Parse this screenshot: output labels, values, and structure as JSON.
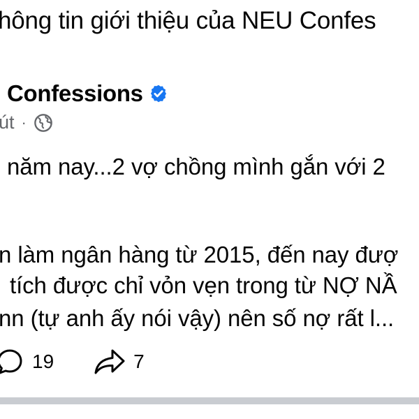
{
  "top_text": "hông tin giới thiệu của NEU Confes",
  "post": {
    "page_name": "Confessions",
    "time": "út",
    "separator": "·",
    "lines": [
      "năm nay...2 vợ chồng mình gắn với 2",
      "n làm ngân hàng từ 2015, đến nay đượ",
      "tích được chỉ vỏn vẹn trong từ NỢ NẦ",
      "nn (tự anh ấy nói vậy) nên số nợ rất l..."
    ],
    "comments_count": "19",
    "shares_count": "7"
  },
  "colors": {
    "verified": "#1877f2",
    "meta_text": "#65676b",
    "divider": "#c9ccd1"
  },
  "icons": {
    "verified": "verified-badge-icon",
    "audience": "globe-icon",
    "comment": "comment-bubble-icon",
    "share": "share-arrow-icon"
  }
}
